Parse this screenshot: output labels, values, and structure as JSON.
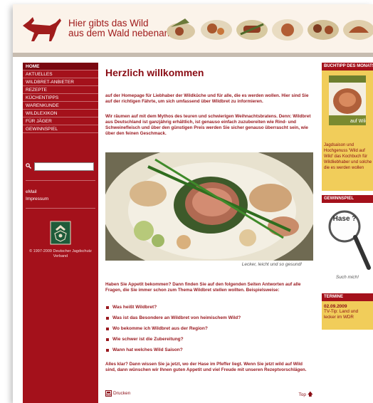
{
  "header": {
    "tagline_line1": "Hier gibts das Wild",
    "tagline_line2": "aus dem Wald nebenan!"
  },
  "nav": {
    "items": [
      "HOME",
      "AKTUELLES",
      "WILDBRET-ANBIETER",
      "REZEPTE",
      "KÜCHENTIPPS",
      "WARENKUNDE",
      "WILDLEXIKON",
      "FÜR JÄGER",
      "GEWINNSPIEL"
    ],
    "active": "HOME",
    "email": "eMail",
    "impressum": "Impressum",
    "copyright": "© 1997-2009 Deutscher Jagdschutz Verband"
  },
  "main": {
    "title": "Herzlich willkommen",
    "p1": "auf der Homepage für Liebhaber der Wildküche und für alle, die es werden wollen. Hier sind Sie auf der richtigen Fährte, um sich umfassend über Wildbret zu informieren.",
    "p2": "Wir räumen auf mit dem Mythos des teuren und schwierigen Weihnachtsbratens. Denn: Wildbret aus Deutschland ist ganzjährig erhältlich, ist genauso einfach zuzubereiten wie Rind- und Schweinefleisch und über den günstigen Preis werden Sie sicher genauso überrascht sein, wie über den feinen Geschmack.",
    "caption": "Lecker, leicht und so gesund!",
    "p3": "Haben Sie Appetit bekommen? Dann finden Sie auf den folgenden Seiten Antworten auf alle Fragen, die Sie immer schon zum Thema Wildbret stellen wollten. Beispielsweise:",
    "bullets": [
      "Was heißt Wildbret?",
      "Was ist das Besondere an Wildbret von heimischem Wild?",
      "Wo bekomme ich Wildbret aus der Region?",
      "Wie schwer ist die Zubereitung?",
      "Wann hat welches Wild Saison?"
    ],
    "p4": "Alles klar? Dann wissen Sie ja jetzt, wo der Hase im Pfeffer liegt. Wenn Sie jetzt wild auf Wild sind, dann wünschen wir Ihnen guten Appetit und viel Freude mit unseren Rezeptvorschlägen.",
    "print_label": "Drucken",
    "top_label": "Top"
  },
  "right": {
    "book_head": "BUCHTIPP DES MONATS",
    "book_text": "Jagdsaison und Hochgenuss 'Wild auf Wild' das Kochbuch für Wildliebhaber und solche die es werden wollen",
    "gew_head": "GEWINNSPIEL",
    "hase_text": "Hase ?",
    "hase_caption": "Such mich!",
    "term_head": "TERMINE",
    "term_date": "02.09.2009",
    "term_text": "TV-Tip: Land und lecker im WDR"
  },
  "colors": {
    "brand_red": "#a4111b",
    "header_bg": "#fbf3ea",
    "box_yellow": "#f1cd5a"
  }
}
